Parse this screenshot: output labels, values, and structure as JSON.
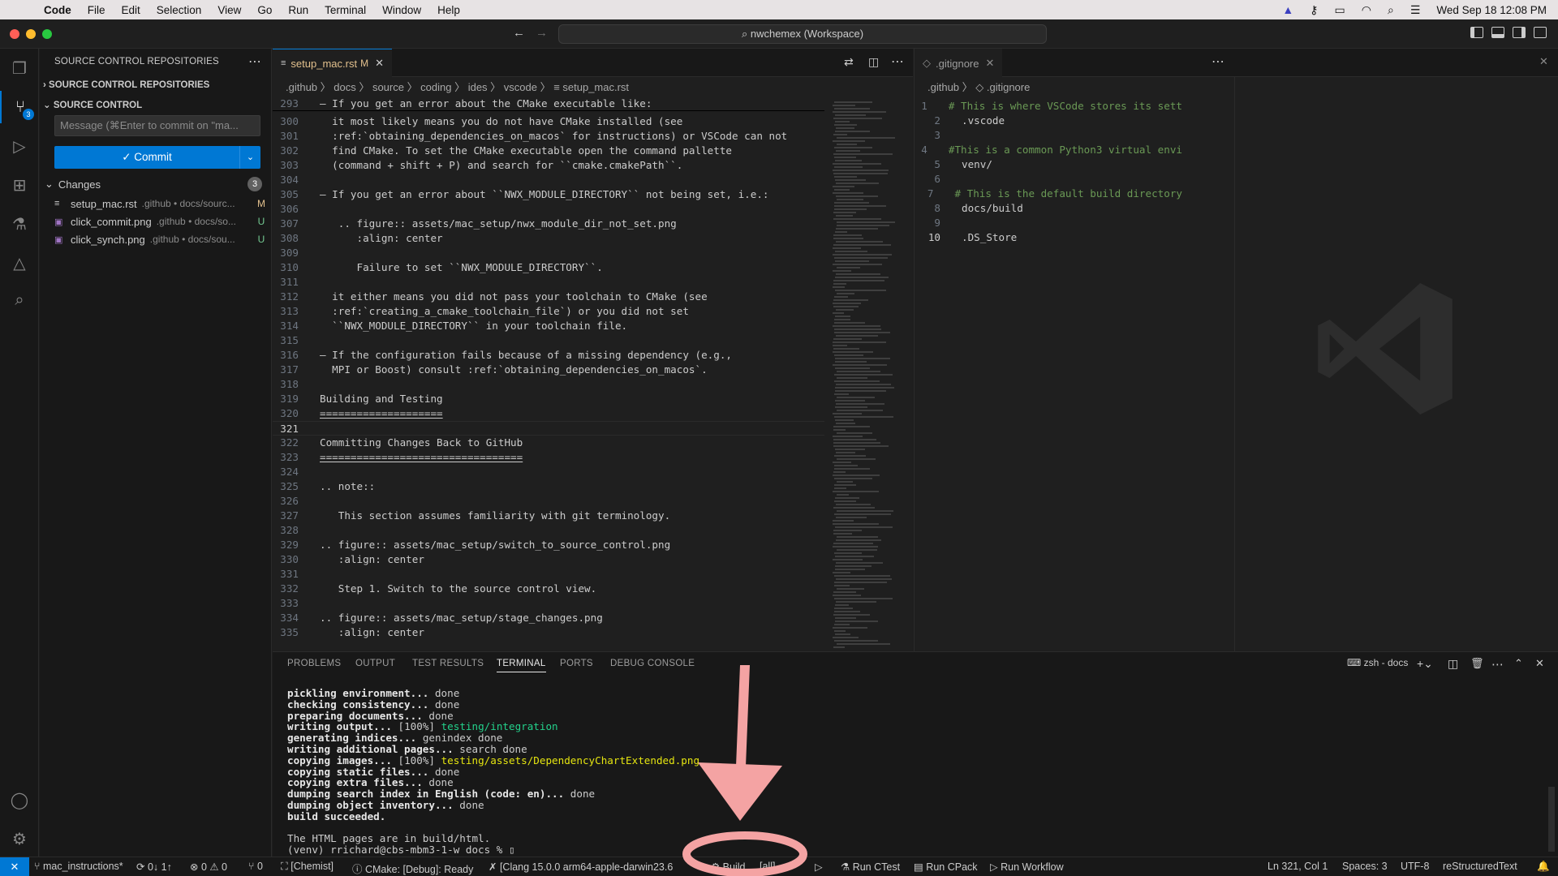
{
  "menubar": {
    "app": "Code",
    "menus": [
      "File",
      "Edit",
      "Selection",
      "View",
      "Go",
      "Run",
      "Terminal",
      "Window",
      "Help"
    ],
    "datetime": "Wed Sep 18  12:08 PM"
  },
  "titlebar": {
    "search": "nwchemex (Workspace)"
  },
  "activity": {
    "scm_badge": "3"
  },
  "sidebar": {
    "header": "SOURCE CONTROL REPOSITORIES",
    "repos_section": "SOURCE CONTROL REPOSITORIES",
    "scm_section": "SOURCE CONTROL",
    "commit_placeholder": "Message (⌘Enter to commit on \"ma...",
    "commit_label": "✓ Commit",
    "changes_label": "Changes",
    "changes_count": "3",
    "files": [
      {
        "name": "setup_mac.rst",
        "path": ".github • docs/sourc...",
        "status": "M"
      },
      {
        "name": "click_commit.png",
        "path": ".github • docs/so...",
        "status": "U"
      },
      {
        "name": "click_synch.png",
        "path": ".github • docs/sou...",
        "status": "U"
      }
    ]
  },
  "editor1": {
    "tab_name": "setup_mac.rst",
    "tab_status": "M",
    "breadcrumb": ".github  〉 docs  〉 source  〉 coding  〉 ides  〉 vscode  〉 ≡  setup_mac.rst",
    "sticky": {
      "ln": "293",
      "text": "– If you get an error about the CMake executable like:"
    },
    "lines": [
      {
        "ln": "300",
        "text": "  it most likely means you do not have CMake installed (see"
      },
      {
        "ln": "301",
        "text": "  :ref:`obtaining_dependencies_on_macos` for instructions) or VSCode can not"
      },
      {
        "ln": "302",
        "text": "  find CMake. To set the CMake executable open the command pallette"
      },
      {
        "ln": "303",
        "text": "  (command + shift + P) and search for ``cmake.cmakePath``."
      },
      {
        "ln": "304",
        "text": ""
      },
      {
        "ln": "305",
        "text": "– If you get an error about ``NWX_MODULE_DIRECTORY`` not being set, i.e.:"
      },
      {
        "ln": "306",
        "text": ""
      },
      {
        "ln": "307",
        "text": "   .. figure:: assets/mac_setup/nwx_module_dir_not_set.png"
      },
      {
        "ln": "308",
        "text": "      :align: center"
      },
      {
        "ln": "309",
        "text": ""
      },
      {
        "ln": "310",
        "text": "      Failure to set ``NWX_MODULE_DIRECTORY``."
      },
      {
        "ln": "311",
        "text": ""
      },
      {
        "ln": "312",
        "text": "  it either means you did not pass your toolchain to CMake (see"
      },
      {
        "ln": "313",
        "text": "  :ref:`creating_a_cmake_toolchain_file`) or you did not set"
      },
      {
        "ln": "314",
        "text": "  ``NWX_MODULE_DIRECTORY`` in your toolchain file."
      },
      {
        "ln": "315",
        "text": ""
      },
      {
        "ln": "316",
        "text": "– If the configuration fails because of a missing dependency (e.g.,"
      },
      {
        "ln": "317",
        "text": "  MPI or Boost) consult :ref:`obtaining_dependencies_on_macos`."
      },
      {
        "ln": "318",
        "text": ""
      },
      {
        "ln": "319",
        "text": "Building and Testing"
      },
      {
        "ln": "320",
        "text": "===================="
      },
      {
        "ln": "321",
        "text": ""
      },
      {
        "ln": "322",
        "text": "Committing Changes Back to GitHub"
      },
      {
        "ln": "323",
        "text": "================================="
      },
      {
        "ln": "324",
        "text": ""
      },
      {
        "ln": "325",
        "text": ".. note::"
      },
      {
        "ln": "326",
        "text": ""
      },
      {
        "ln": "327",
        "text": "   This section assumes familiarity with git terminology."
      },
      {
        "ln": "328",
        "text": ""
      },
      {
        "ln": "329",
        "text": ".. figure:: assets/mac_setup/switch_to_source_control.png"
      },
      {
        "ln": "330",
        "text": "   :align: center"
      },
      {
        "ln": "331",
        "text": ""
      },
      {
        "ln": "332",
        "text": "   Step 1. Switch to the source control view."
      },
      {
        "ln": "333",
        "text": ""
      },
      {
        "ln": "334",
        "text": ".. figure:: assets/mac_setup/stage_changes.png"
      },
      {
        "ln": "335",
        "text": "   :align: center"
      }
    ]
  },
  "editor2": {
    "tab_name": ".gitignore",
    "breadcrumb": ".github  〉 ◇  .gitignore",
    "lines": [
      {
        "ln": "1",
        "text": "# This is where VSCode stores its sett"
      },
      {
        "ln": "2",
        "text": ".vscode"
      },
      {
        "ln": "3",
        "text": ""
      },
      {
        "ln": "4",
        "text": "#This is a common Python3 virtual envi"
      },
      {
        "ln": "5",
        "text": "venv/"
      },
      {
        "ln": "6",
        "text": ""
      },
      {
        "ln": "7",
        "text": "# This is the default build directory"
      },
      {
        "ln": "8",
        "text": "docs/build"
      },
      {
        "ln": "9",
        "text": ""
      },
      {
        "ln": "10",
        "text": ".DS_Store"
      }
    ]
  },
  "panel": {
    "tabs": [
      "PROBLEMS",
      "OUTPUT",
      "TEST RESULTS",
      "TERMINAL",
      "PORTS",
      "DEBUG CONSOLE"
    ],
    "active_tab": "TERMINAL",
    "terminal_name": "zsh - docs",
    "terminal": [
      {
        "b": "pickling environment...",
        "rest": " done"
      },
      {
        "b": "checking consistency...",
        "rest": " done"
      },
      {
        "b": "preparing documents...",
        "rest": " done"
      },
      {
        "b": "writing output...",
        "rest": " [100%] ",
        "color": "testing/integration",
        "cls": "t-green"
      },
      {
        "b": "generating indices...",
        "rest": " genindex done"
      },
      {
        "b": "writing additional pages...",
        "rest": " search done"
      },
      {
        "b": "copying images...",
        "rest": " [100%] ",
        "color": "testing/assets/DependencyChartExtended.png",
        "cls": "t-yellow"
      },
      {
        "b": "copying static files...",
        "rest": " done"
      },
      {
        "b": "copying extra files...",
        "rest": " done"
      },
      {
        "b": "dumping search index in English (code: en)...",
        "rest": " done"
      },
      {
        "b": "dumping object inventory...",
        "rest": " done"
      },
      {
        "b": "build succeeded.",
        "rest": ""
      },
      {
        "b": "",
        "rest": ""
      },
      {
        "b": "",
        "rest": "The HTML pages are in build/html."
      },
      {
        "b": "",
        "rest": "(venv) rrichard@cbs-mbm3-1-w docs % ▯"
      }
    ]
  },
  "statusbar": {
    "branch": "mac_instructions*",
    "sync": "0↓ 1↑",
    "problems": "⊗ 0 ⚠ 0",
    "ports": "⑂ 0",
    "kit": "[Chemist]",
    "cmake": "ⓘ CMake: [Debug]: Ready",
    "compiler": "✗ [Clang 15.0.0 arm64-apple-darwin23.6",
    "build": "⚙ Build",
    "target": "[all]",
    "ctest": "Run CTest",
    "cpack": "Run CPack",
    "workflow": "Run Workflow",
    "position": "Ln 321, Col 1",
    "spaces": "Spaces: 3",
    "encoding": "UTF-8",
    "language": "reStructuredText"
  }
}
